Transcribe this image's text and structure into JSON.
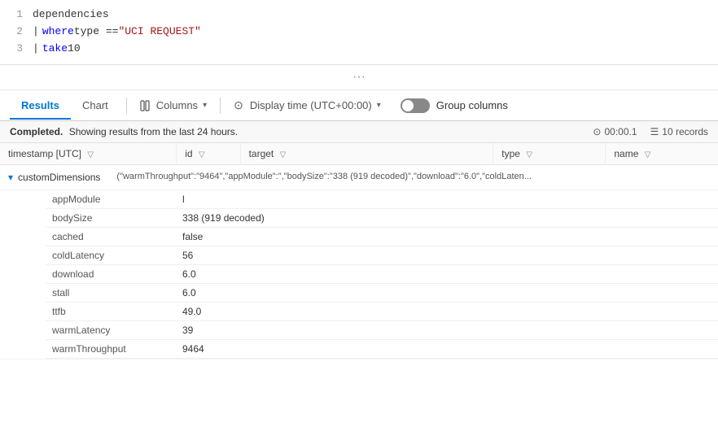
{
  "editor": {
    "lines": [
      {
        "number": 1,
        "parts": [
          {
            "text": "dependencies",
            "type": "plain"
          }
        ]
      },
      {
        "number": 2,
        "parts": [
          {
            "text": "| ",
            "type": "pipe"
          },
          {
            "text": "where ",
            "type": "keyword"
          },
          {
            "text": "type == ",
            "type": "plain"
          },
          {
            "text": "\"UCI REQUEST\"",
            "type": "string"
          }
        ]
      },
      {
        "number": 3,
        "parts": [
          {
            "text": "| ",
            "type": "pipe"
          },
          {
            "text": "take ",
            "type": "keyword"
          },
          {
            "text": "10",
            "type": "plain"
          }
        ]
      }
    ]
  },
  "tabs": {
    "items": [
      {
        "label": "Results",
        "active": true
      },
      {
        "label": "Chart",
        "active": false
      }
    ]
  },
  "toolbar": {
    "columns_label": "Columns",
    "display_time_label": "Display time (UTC+00:00)",
    "group_columns_label": "Group columns"
  },
  "status": {
    "completed_text": "Completed.",
    "showing_text": "Showing results from the last 24 hours.",
    "time_value": "00:00.1",
    "records_value": "10 records"
  },
  "table": {
    "columns": [
      {
        "label": "timestamp [UTC]",
        "filter": true
      },
      {
        "label": "id",
        "filter": true
      },
      {
        "label": "target",
        "filter": true
      },
      {
        "label": "type",
        "filter": true
      },
      {
        "label": "name",
        "filter": true
      }
    ],
    "expanded_row": {
      "label": "customDimensions",
      "preview": "(\"warmThroughput\":\"9464\",\"appModule\":\"",
      "end_preview": ",\"bodySize\":\"338 (919 decoded)\",\"download\":\"6.0\",\"coldLaten..."
    },
    "sub_rows": [
      {
        "key": "appModule",
        "value": "l"
      },
      {
        "key": "bodySize",
        "value": "338 (919 decoded)"
      },
      {
        "key": "cached",
        "value": "false"
      },
      {
        "key": "coldLatency",
        "value": "56"
      },
      {
        "key": "download",
        "value": "6.0"
      },
      {
        "key": "stall",
        "value": "6.0"
      },
      {
        "key": "ttfb",
        "value": "49.0"
      },
      {
        "key": "warmLatency",
        "value": "39"
      },
      {
        "key": "warmThroughput",
        "value": "9464"
      }
    ]
  }
}
